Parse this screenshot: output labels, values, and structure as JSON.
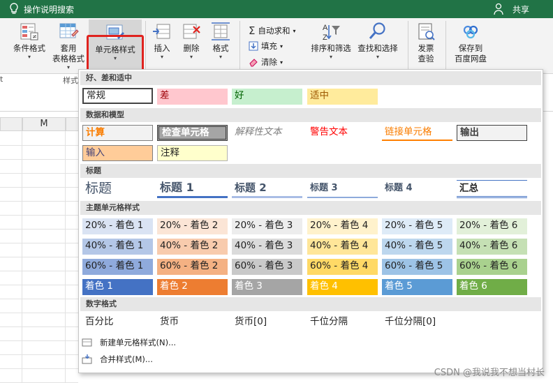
{
  "topbar": {
    "search_label": "操作说明搜索",
    "share_label": "共享"
  },
  "ribbon": {
    "conditional_format": "条件格式",
    "table_format_line1": "套用",
    "table_format_line2": "表格格式",
    "cell_styles": "单元格样式",
    "insert": "插入",
    "delete": "删除",
    "format": "格式",
    "autosum": "自动求和",
    "fill": "填充",
    "clear": "清除",
    "sort_filter": "排序和筛选",
    "find_select": "查找和选择",
    "invoice_line1": "发票",
    "invoice_line2": "查验",
    "save_line1": "保存到",
    "save_line2": "百度网盘",
    "styles_group_partial": "样式",
    "edge_partial": "t"
  },
  "sheet": {
    "col_m": "M"
  },
  "gallery": {
    "sec_good_bad": "好、差和适中",
    "normal": "常规",
    "bad": "差",
    "good": "好",
    "neutral": "适中",
    "sec_data_model": "数据和模型",
    "calculation": "计算",
    "check_cell": "检查单元格",
    "explanatory": "解释性文本",
    "warning": "警告文本",
    "linked_cell": "链接单元格",
    "output": "输出",
    "input": "输入",
    "note": "注释",
    "sec_titles": "标题",
    "title": "标题",
    "heading1": "标题 1",
    "heading2": "标题 2",
    "heading3": "标题 3",
    "heading4": "标题 4",
    "total": "汇总",
    "sec_theme": "主题单元格样式",
    "theme_rows": [
      [
        "20% - 着色 1",
        "20% - 着色 2",
        "20% - 着色 3",
        "20% - 着色 4",
        "20% - 着色 5",
        "20% - 着色 6"
      ],
      [
        "40% - 着色 1",
        "40% - 着色 2",
        "40% - 着色 3",
        "40% - 着色 4",
        "40% - 着色 5",
        "40% - 着色 6"
      ],
      [
        "60% - 着色 1",
        "60% - 着色 2",
        "60% - 着色 3",
        "60% - 着色 4",
        "60% - 着色 5",
        "60% - 着色 6"
      ],
      [
        "着色 1",
        "着色 2",
        "着色 3",
        "着色 4",
        "着色 5",
        "着色 6"
      ]
    ],
    "sec_number": "数字格式",
    "percent": "百分比",
    "currency": "货币",
    "currency0": "货币[0]",
    "comma": "千位分隔",
    "comma0": "千位分隔[0]",
    "new_style": "新建单元格样式(N)...",
    "merge_styles": "合并样式(M)..."
  },
  "watermark": "CSDN @我说我不想当村长",
  "colors": {
    "excel_green": "#217346",
    "highlight_red": "#e0231f",
    "accent": [
      "#4472c4",
      "#ed7d31",
      "#a5a5a5",
      "#ffc000",
      "#5b9bd5",
      "#70ad47"
    ],
    "tint20": [
      "#dae3f3",
      "#fbe5d6",
      "#ededed",
      "#fff2cc",
      "#deebf7",
      "#e2f0d9"
    ],
    "tint40": [
      "#b4c7e7",
      "#f8cbad",
      "#dbdbdb",
      "#ffe699",
      "#bdd7ee",
      "#c5e0b4"
    ],
    "tint60": [
      "#8faadc",
      "#f4b183",
      "#c9c9c9",
      "#ffd966",
      "#9dc3e6",
      "#a9d18e"
    ]
  }
}
